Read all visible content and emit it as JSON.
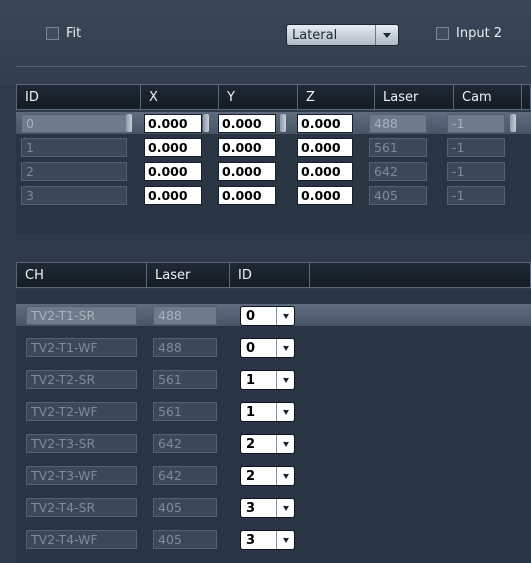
{
  "top": {
    "fit_label": "Fit",
    "mode_value": "Lateral",
    "input2_label": "Input 2"
  },
  "table1": {
    "columns": [
      "ID",
      "X",
      "Y",
      "Z",
      "Laser",
      "Cam"
    ],
    "rows": [
      {
        "id": "0",
        "x": "0.000",
        "y": "0.000",
        "z": "0.000",
        "laser": "488",
        "cam": "-1"
      },
      {
        "id": "1",
        "x": "0.000",
        "y": "0.000",
        "z": "0.000",
        "laser": "561",
        "cam": "-1"
      },
      {
        "id": "2",
        "x": "0.000",
        "y": "0.000",
        "z": "0.000",
        "laser": "642",
        "cam": "-1"
      },
      {
        "id": "3",
        "x": "0.000",
        "y": "0.000",
        "z": "0.000",
        "laser": "405",
        "cam": "-1"
      }
    ]
  },
  "table2": {
    "columns": [
      "CH",
      "Laser",
      "ID"
    ],
    "rows": [
      {
        "ch": "TV2-T1-SR",
        "laser": "488",
        "id": "0"
      },
      {
        "ch": "TV2-T1-WF",
        "laser": "488",
        "id": "0"
      },
      {
        "ch": "TV2-T2-SR",
        "laser": "561",
        "id": "1"
      },
      {
        "ch": "TV2-T2-WF",
        "laser": "561",
        "id": "1"
      },
      {
        "ch": "TV2-T3-SR",
        "laser": "642",
        "id": "2"
      },
      {
        "ch": "TV2-T3-WF",
        "laser": "642",
        "id": "2"
      },
      {
        "ch": "TV2-T4-SR",
        "laser": "405",
        "id": "3"
      },
      {
        "ch": "TV2-T4-WF",
        "laser": "405",
        "id": "3"
      }
    ]
  }
}
